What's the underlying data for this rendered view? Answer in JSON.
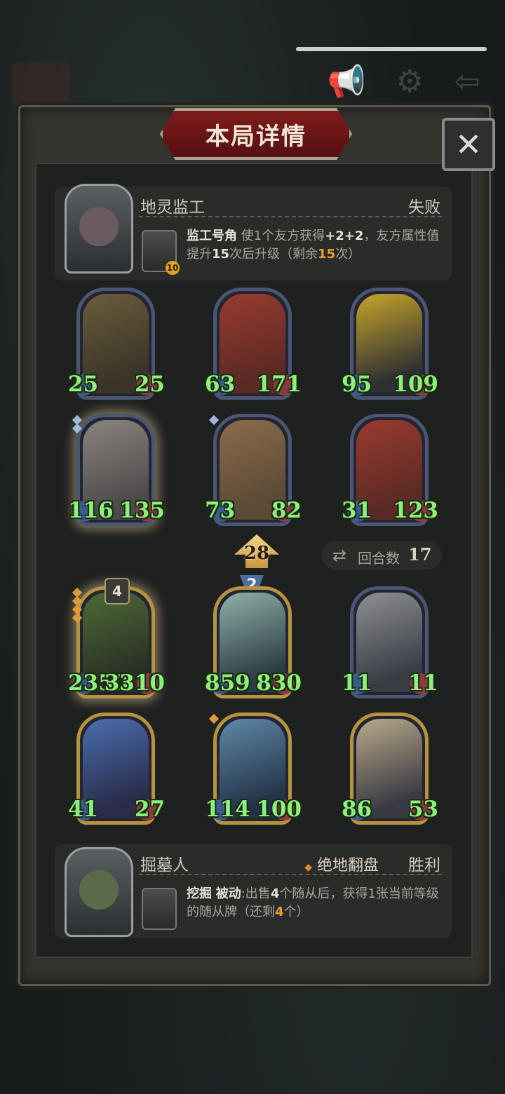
{
  "title": "本局详情",
  "close_label": "✕",
  "opponent": {
    "name": "地灵监工",
    "result": "失败",
    "skill_level": "10",
    "skill_name": "监工号角",
    "desc_a": "使1个友方获得",
    "desc_bonus": "+2+2",
    "desc_b": "，友方属性值提升",
    "desc_num": "15",
    "desc_c": "次后升级（剩余",
    "desc_remain": "15",
    "desc_d": "次）"
  },
  "opponent_board": [
    {
      "atk": "25",
      "hp": "25",
      "frame": "blue",
      "colors": [
        "#3a3528",
        "#6b5c3b"
      ]
    },
    {
      "atk": "63",
      "hp": "171",
      "frame": "blue",
      "colors": [
        "#5a2a24",
        "#9a3b30"
      ]
    },
    {
      "atk": "95",
      "hp": "109",
      "frame": "blue",
      "colors": [
        "#2e2f33",
        "#c7a52a"
      ]
    },
    {
      "atk": "116",
      "hp": "135",
      "frame": "blue",
      "glow": true,
      "pips": 2,
      "colors": [
        "#4d4a4a",
        "#8b8580"
      ]
    },
    {
      "atk": "73",
      "hp": "82",
      "frame": "blue",
      "pips": 1,
      "colors": [
        "#5c4a36",
        "#8b6c4b"
      ]
    },
    {
      "atk": "31",
      "hp": "123",
      "frame": "blue",
      "colors": [
        "#5a2a24",
        "#9a3b30"
      ]
    }
  ],
  "round": {
    "label": "回合数",
    "value": "17"
  },
  "level_up": {
    "value": "28"
  },
  "tier": {
    "value": "2"
  },
  "player_board": [
    {
      "atk": "2350",
      "hp": "3310",
      "frame": "gold",
      "glow": true,
      "tier": "4",
      "opips": 4,
      "colors": [
        "#2a2f26",
        "#4e6b35"
      ]
    },
    {
      "atk": "859",
      "hp": "830",
      "frame": "gold",
      "colors": [
        "#2c3c44",
        "#8fb0a8"
      ]
    },
    {
      "atk": "11",
      "hp": "11",
      "frame": "blue",
      "colors": [
        "#3a3d44",
        "#8d8f94"
      ]
    },
    {
      "atk": "41",
      "hp": "27",
      "frame": "gold",
      "colors": [
        "#2a2c4a",
        "#4a6fb0"
      ]
    },
    {
      "atk": "114",
      "hp": "100",
      "frame": "gold",
      "opips": 1,
      "colors": [
        "#233448",
        "#5f87a8"
      ]
    },
    {
      "atk": "86",
      "hp": "53",
      "frame": "gold",
      "colors": [
        "#3a3a44",
        "#b9a98a"
      ]
    }
  ],
  "player": {
    "name": "掘墓人",
    "badge": "绝地翻盘",
    "result": "胜利",
    "skill_name": "挖掘",
    "passive_label": "被动",
    "desc_a": ":出售",
    "desc_num": "4",
    "desc_b": "个随从后，获得1张当前等级的随从牌（还剩",
    "desc_remain": "4",
    "desc_c": "个）"
  },
  "colors": {
    "stat_green": "#8df07a",
    "accent_orange": "#f0a030",
    "banner_red": "#7e1c1c"
  }
}
